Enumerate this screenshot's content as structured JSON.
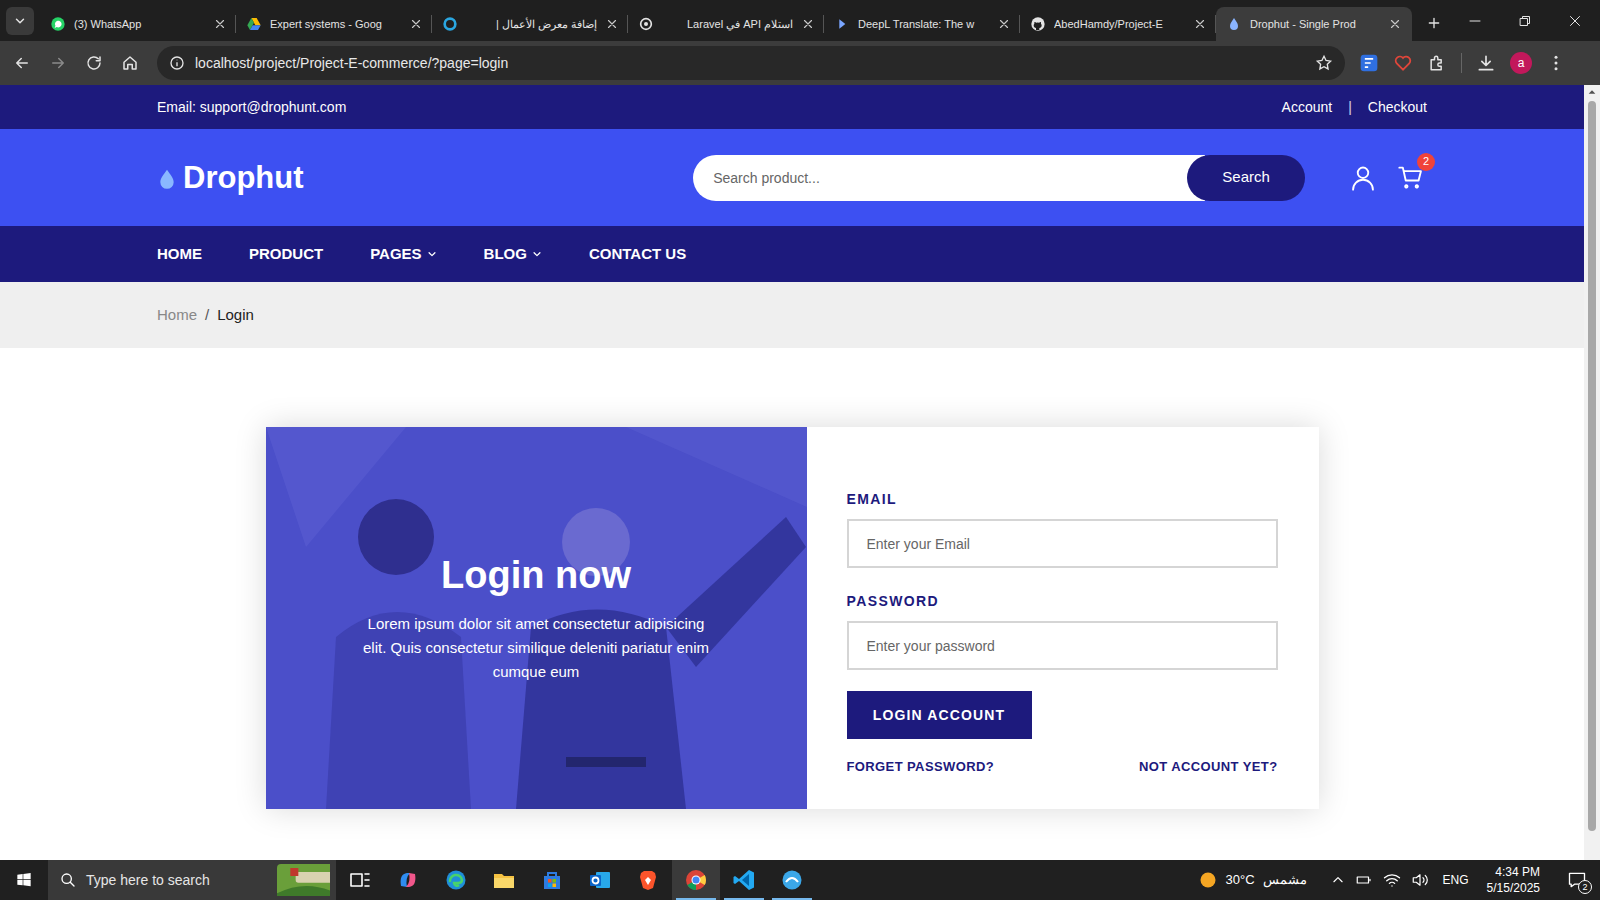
{
  "browser": {
    "tabs": [
      {
        "label": "(3) WhatsApp",
        "kind": "whatsapp",
        "selected": false
      },
      {
        "label": "Expert systems - Goog",
        "kind": "drive",
        "selected": false
      },
      {
        "label": "إضافة معرض الأعمال |",
        "kind": "mostaql",
        "selected": false
      },
      {
        "label": "استلام API في Laravel",
        "kind": "chatgpt",
        "selected": false
      },
      {
        "label": "DeepL Translate: The w",
        "kind": "deepl",
        "selected": false
      },
      {
        "label": "AbedHamdy/Project-E",
        "kind": "github",
        "selected": false
      },
      {
        "label": "Drophut - Single Prod",
        "kind": "drophut",
        "selected": true
      }
    ],
    "url": "localhost/project/Project-E-commerce/?page=login",
    "bookmarked": false,
    "profile": "a"
  },
  "site": {
    "topbar": {
      "email": "Email: support@drophunt.com",
      "links": [
        {
          "label": "Account"
        },
        {
          "label": "Checkout"
        }
      ],
      "separator": "|"
    },
    "logo": "Drophut",
    "search": {
      "placeholder": "Search product...",
      "button": "Search"
    },
    "cart_count": "2",
    "nav": [
      {
        "label": "HOME",
        "dropdown": false
      },
      {
        "label": "PRODUCT",
        "dropdown": false
      },
      {
        "label": "PAGES",
        "dropdown": true
      },
      {
        "label": "BLOG",
        "dropdown": true
      },
      {
        "label": "CONTACT US",
        "dropdown": false
      }
    ],
    "breadcrumb": {
      "home": "Home",
      "separator": "/",
      "current": "Login"
    },
    "login": {
      "title": "Login now",
      "text": "Lorem ipsum dolor sit amet consectetur adipisicing elit. Quis consectetur similique deleniti pariatur enim cumque eum",
      "email_label": "EMAIL",
      "email_placeholder": "Enter your Email",
      "password_label": "PASSWORD",
      "password_placeholder": "Enter your password",
      "button": "LOGIN ACCOUNT",
      "forgot": "FORGET PASSWORD?",
      "signup": "NOT ACCOUNT YET?"
    }
  },
  "taskbar": {
    "search": "Type here to search",
    "apps": [
      {
        "kind": "taskview",
        "selected": false,
        "running": false
      },
      {
        "kind": "copilot",
        "selected": false,
        "running": false
      },
      {
        "kind": "edge",
        "selected": false,
        "running": false
      },
      {
        "kind": "explorer",
        "selected": false,
        "running": false
      },
      {
        "kind": "store",
        "selected": false,
        "running": false
      },
      {
        "kind": "outlook",
        "selected": false,
        "running": false
      },
      {
        "kind": "brave",
        "selected": false,
        "running": false
      },
      {
        "kind": "chrome",
        "selected": true,
        "running": true
      },
      {
        "kind": "vscode",
        "selected": false,
        "running": true
      },
      {
        "kind": "app",
        "selected": false,
        "running": true
      }
    ],
    "weather": {
      "temp": "30°C",
      "desc": "مشمس"
    },
    "lang": "ENG",
    "time": "4:34 PM",
    "date": "5/15/2025",
    "notifications": "2"
  }
}
